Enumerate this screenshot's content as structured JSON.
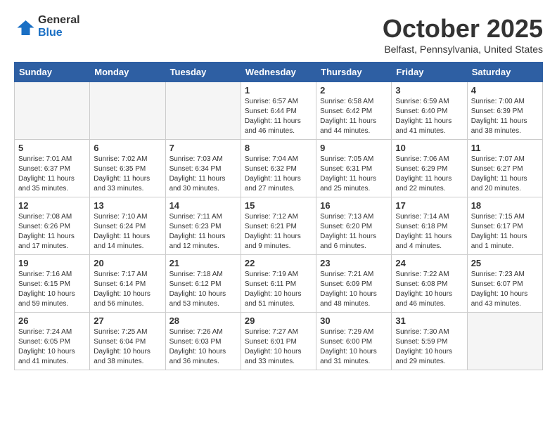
{
  "header": {
    "logo_general": "General",
    "logo_blue": "Blue",
    "title": "October 2025",
    "location": "Belfast, Pennsylvania, United States"
  },
  "days_of_week": [
    "Sunday",
    "Monday",
    "Tuesday",
    "Wednesday",
    "Thursday",
    "Friday",
    "Saturday"
  ],
  "weeks": [
    [
      {
        "day": "",
        "empty": true
      },
      {
        "day": "",
        "empty": true
      },
      {
        "day": "",
        "empty": true
      },
      {
        "day": "1",
        "sunrise": "6:57 AM",
        "sunset": "6:44 PM",
        "daylight": "11 hours and 46 minutes."
      },
      {
        "day": "2",
        "sunrise": "6:58 AM",
        "sunset": "6:42 PM",
        "daylight": "11 hours and 44 minutes."
      },
      {
        "day": "3",
        "sunrise": "6:59 AM",
        "sunset": "6:40 PM",
        "daylight": "11 hours and 41 minutes."
      },
      {
        "day": "4",
        "sunrise": "7:00 AM",
        "sunset": "6:39 PM",
        "daylight": "11 hours and 38 minutes."
      }
    ],
    [
      {
        "day": "5",
        "sunrise": "7:01 AM",
        "sunset": "6:37 PM",
        "daylight": "11 hours and 35 minutes."
      },
      {
        "day": "6",
        "sunrise": "7:02 AM",
        "sunset": "6:35 PM",
        "daylight": "11 hours and 33 minutes."
      },
      {
        "day": "7",
        "sunrise": "7:03 AM",
        "sunset": "6:34 PM",
        "daylight": "11 hours and 30 minutes."
      },
      {
        "day": "8",
        "sunrise": "7:04 AM",
        "sunset": "6:32 PM",
        "daylight": "11 hours and 27 minutes."
      },
      {
        "day": "9",
        "sunrise": "7:05 AM",
        "sunset": "6:31 PM",
        "daylight": "11 hours and 25 minutes."
      },
      {
        "day": "10",
        "sunrise": "7:06 AM",
        "sunset": "6:29 PM",
        "daylight": "11 hours and 22 minutes."
      },
      {
        "day": "11",
        "sunrise": "7:07 AM",
        "sunset": "6:27 PM",
        "daylight": "11 hours and 20 minutes."
      }
    ],
    [
      {
        "day": "12",
        "sunrise": "7:08 AM",
        "sunset": "6:26 PM",
        "daylight": "11 hours and 17 minutes."
      },
      {
        "day": "13",
        "sunrise": "7:10 AM",
        "sunset": "6:24 PM",
        "daylight": "11 hours and 14 minutes."
      },
      {
        "day": "14",
        "sunrise": "7:11 AM",
        "sunset": "6:23 PM",
        "daylight": "11 hours and 12 minutes."
      },
      {
        "day": "15",
        "sunrise": "7:12 AM",
        "sunset": "6:21 PM",
        "daylight": "11 hours and 9 minutes."
      },
      {
        "day": "16",
        "sunrise": "7:13 AM",
        "sunset": "6:20 PM",
        "daylight": "11 hours and 6 minutes."
      },
      {
        "day": "17",
        "sunrise": "7:14 AM",
        "sunset": "6:18 PM",
        "daylight": "11 hours and 4 minutes."
      },
      {
        "day": "18",
        "sunrise": "7:15 AM",
        "sunset": "6:17 PM",
        "daylight": "11 hours and 1 minute."
      }
    ],
    [
      {
        "day": "19",
        "sunrise": "7:16 AM",
        "sunset": "6:15 PM",
        "daylight": "10 hours and 59 minutes."
      },
      {
        "day": "20",
        "sunrise": "7:17 AM",
        "sunset": "6:14 PM",
        "daylight": "10 hours and 56 minutes."
      },
      {
        "day": "21",
        "sunrise": "7:18 AM",
        "sunset": "6:12 PM",
        "daylight": "10 hours and 53 minutes."
      },
      {
        "day": "22",
        "sunrise": "7:19 AM",
        "sunset": "6:11 PM",
        "daylight": "10 hours and 51 minutes."
      },
      {
        "day": "23",
        "sunrise": "7:21 AM",
        "sunset": "6:09 PM",
        "daylight": "10 hours and 48 minutes."
      },
      {
        "day": "24",
        "sunrise": "7:22 AM",
        "sunset": "6:08 PM",
        "daylight": "10 hours and 46 minutes."
      },
      {
        "day": "25",
        "sunrise": "7:23 AM",
        "sunset": "6:07 PM",
        "daylight": "10 hours and 43 minutes."
      }
    ],
    [
      {
        "day": "26",
        "sunrise": "7:24 AM",
        "sunset": "6:05 PM",
        "daylight": "10 hours and 41 minutes."
      },
      {
        "day": "27",
        "sunrise": "7:25 AM",
        "sunset": "6:04 PM",
        "daylight": "10 hours and 38 minutes."
      },
      {
        "day": "28",
        "sunrise": "7:26 AM",
        "sunset": "6:03 PM",
        "daylight": "10 hours and 36 minutes."
      },
      {
        "day": "29",
        "sunrise": "7:27 AM",
        "sunset": "6:01 PM",
        "daylight": "10 hours and 33 minutes."
      },
      {
        "day": "30",
        "sunrise": "7:29 AM",
        "sunset": "6:00 PM",
        "daylight": "10 hours and 31 minutes."
      },
      {
        "day": "31",
        "sunrise": "7:30 AM",
        "sunset": "5:59 PM",
        "daylight": "10 hours and 29 minutes."
      },
      {
        "day": "",
        "empty": true
      }
    ]
  ]
}
